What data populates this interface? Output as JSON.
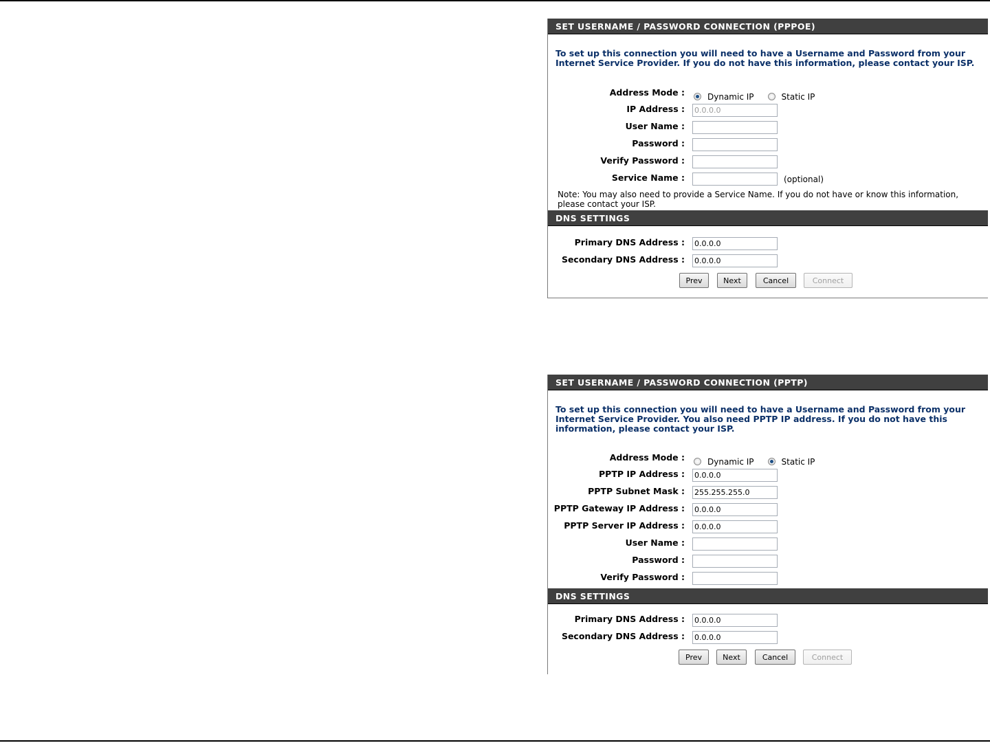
{
  "pppoe": {
    "title": "SET USERNAME / PASSWORD CONNECTION (PPPOE)",
    "intro": "To set up this connection you will need to have a Username and Password from your Internet Service Provider. If you do not have this information, please contact your ISP.",
    "address_mode_label": "Address Mode :",
    "radio_dynamic": "Dynamic IP",
    "radio_static": "Static IP",
    "selected_mode": "Dynamic IP",
    "ip_address_label": "IP Address :",
    "ip_address_value": "0.0.0.0",
    "user_name_label": "User Name :",
    "user_name_value": "",
    "password_label": "Password :",
    "verify_password_label": "Verify Password :",
    "service_name_label": "Service Name :",
    "service_name_value": "",
    "optional_text": "(optional)",
    "note": "Note: You may also need to provide a Service Name. If you do not have or know this information, please contact your ISP.",
    "dns_title": "DNS SETTINGS",
    "primary_dns_label": "Primary DNS Address :",
    "primary_dns_value": "0.0.0.0",
    "secondary_dns_label": "Secondary DNS Address :",
    "secondary_dns_value": "0.0.0.0",
    "buttons": {
      "prev": "Prev",
      "next": "Next",
      "cancel": "Cancel",
      "connect": "Connect"
    }
  },
  "pptp": {
    "title": "SET USERNAME / PASSWORD CONNECTION (PPTP)",
    "intro": "To set up this connection you will need to have a Username and Password from your Internet Service Provider. You also need PPTP IP address. If you do not have this information, please contact your ISP.",
    "address_mode_label": "Address Mode :",
    "radio_dynamic": "Dynamic IP",
    "radio_static": "Static IP",
    "selected_mode": "Static IP",
    "pptp_ip_label": "PPTP IP Address :",
    "pptp_ip_value": "0.0.0.0",
    "pptp_subnet_label": "PPTP Subnet Mask :",
    "pptp_subnet_value": "255.255.255.0",
    "pptp_gateway_label": "PPTP Gateway IP Address :",
    "pptp_gateway_value": "0.0.0.0",
    "pptp_server_label": "PPTP Server IP Address :",
    "pptp_server_value": "0.0.0.0",
    "user_name_label": "User Name :",
    "user_name_value": "",
    "password_label": "Password :",
    "verify_password_label": "Verify Password :",
    "dns_title": "DNS SETTINGS",
    "primary_dns_label": "Primary DNS Address :",
    "primary_dns_value": "0.0.0.0",
    "secondary_dns_label": "Secondary DNS Address :",
    "secondary_dns_value": "0.0.0.0",
    "buttons": {
      "prev": "Prev",
      "next": "Next",
      "cancel": "Cancel",
      "connect": "Connect"
    }
  },
  "icons": {
    "radio_selected": "radio-selected-icon",
    "radio_unselected": "radio-unselected-icon"
  }
}
